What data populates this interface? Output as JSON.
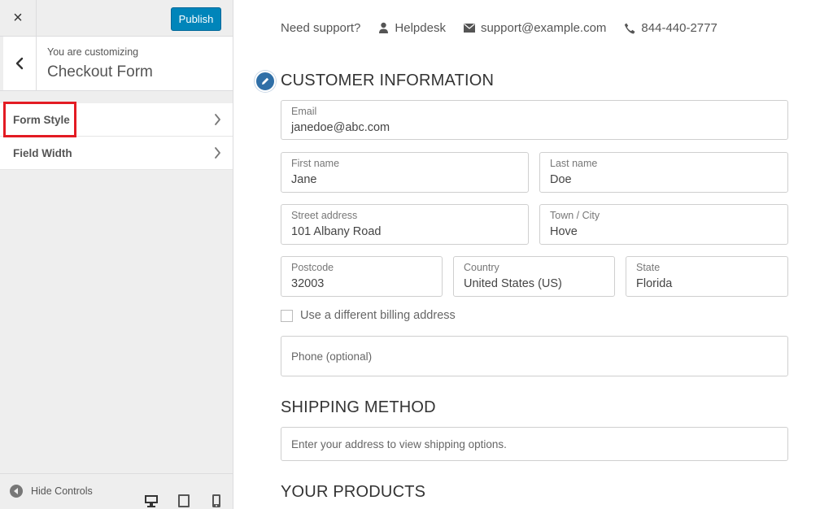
{
  "sidebar": {
    "close_symbol": "×",
    "publish_label": "Publish",
    "customizing_label": "You are customizing",
    "section_title": "Checkout Form",
    "menu": [
      {
        "label": "Form Style"
      },
      {
        "label": "Field Width"
      }
    ],
    "hide_controls_label": "Hide Controls",
    "devices": [
      "desktop-icon",
      "tablet-icon",
      "mobile-icon"
    ]
  },
  "support": {
    "label": "Need support?",
    "helpdesk": "Helpdesk",
    "email": "support@example.com",
    "phone": "844-440-2777"
  },
  "customer": {
    "heading": "CUSTOMER INFORMATION",
    "email": {
      "label": "Email",
      "value": "janedoe@abc.com"
    },
    "first_name": {
      "label": "First name",
      "value": "Jane"
    },
    "last_name": {
      "label": "Last name",
      "value": "Doe"
    },
    "street": {
      "label": "Street address",
      "value": "101 Albany Road"
    },
    "city": {
      "label": "Town / City",
      "value": "Hove"
    },
    "postcode": {
      "label": "Postcode",
      "value": "32003"
    },
    "country": {
      "label": "Country",
      "value": "United States (US)"
    },
    "state": {
      "label": "State",
      "value": "Florida"
    },
    "billing_checkbox": "Use a different billing address",
    "phone_placeholder": "Phone (optional)"
  },
  "shipping": {
    "heading": "SHIPPING METHOD",
    "message": "Enter your address to view shipping options."
  },
  "products": {
    "heading": "YOUR PRODUCTS"
  },
  "colors": {
    "publish": "#0085ba",
    "highlight": "#e31b23",
    "edit_badge": "#2f6fa7"
  }
}
